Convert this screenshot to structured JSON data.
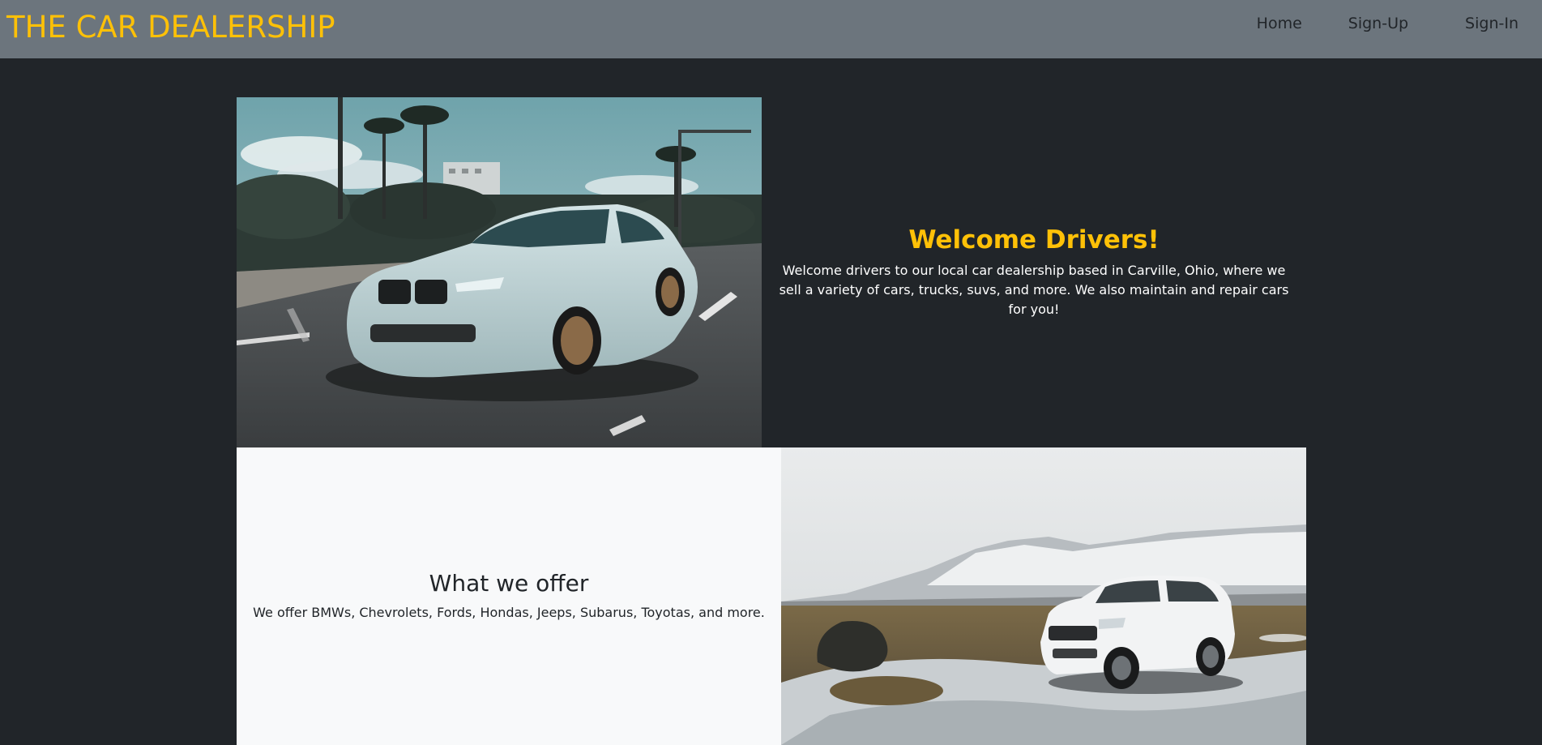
{
  "navbar": {
    "brand": "THE CAR DEALERSHIP",
    "links": {
      "home": "Home",
      "signup": "Sign-Up",
      "signin": "Sign-In"
    }
  },
  "welcome": {
    "title": "Welcome Drivers!",
    "text": "Welcome drivers to our local car dealership based in Carville, Ohio, where we sell a variety of cars, trucks, suvs, and more. We also maintain and repair cars for you!"
  },
  "offer": {
    "title": "What we offer",
    "text": "We offer BMWs, Chevrolets, Fords, Hondas, Jeeps, Subarus, Toyotas, and more."
  },
  "colors": {
    "navbar_bg": "#6c757d",
    "page_bg": "#212529",
    "accent": "#ffc107",
    "light_panel": "#f8f9fa"
  }
}
